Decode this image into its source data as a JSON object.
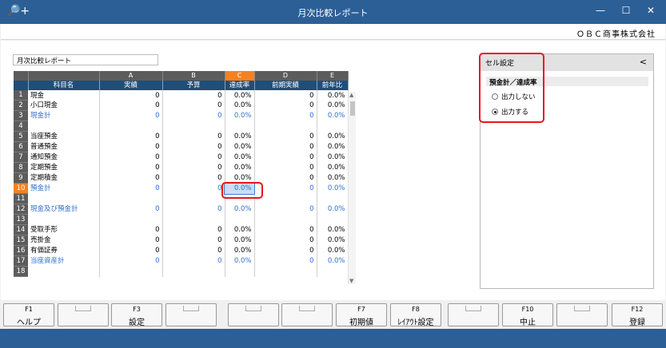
{
  "window": {
    "title": "月次比較レポート",
    "app_icon": "🔎+",
    "min": "—",
    "max": "☐",
    "close": "✕"
  },
  "company": "ＯＢＣ商事株式会社",
  "report_name": "月次比較レポート",
  "grid": {
    "col_letters": [
      "A",
      "B",
      "C",
      "D",
      "E"
    ],
    "headers": [
      "科目名",
      "実績",
      "予算",
      "達成率",
      "前期実績",
      "前年比"
    ],
    "rows": [
      {
        "n": "1",
        "name": "現金",
        "a": "0",
        "b": "0",
        "c": "0.0%",
        "d": "0",
        "e": "0.0%",
        "blue": false
      },
      {
        "n": "2",
        "name": "小口現金",
        "a": "0",
        "b": "0",
        "c": "0.0%",
        "d": "0",
        "e": "0.0%",
        "blue": false
      },
      {
        "n": "3",
        "name": "現金計",
        "a": "0",
        "b": "0",
        "c": "0.0%",
        "d": "0",
        "e": "0.0%",
        "blue": true
      },
      {
        "n": "4",
        "name": "",
        "a": "",
        "b": "",
        "c": "",
        "d": "",
        "e": "",
        "blue": false
      },
      {
        "n": "5",
        "name": "当座預金",
        "a": "0",
        "b": "0",
        "c": "0.0%",
        "d": "0",
        "e": "0.0%",
        "blue": false
      },
      {
        "n": "6",
        "name": "普通預金",
        "a": "0",
        "b": "0",
        "c": "0.0%",
        "d": "0",
        "e": "0.0%",
        "blue": false
      },
      {
        "n": "7",
        "name": "通知預金",
        "a": "0",
        "b": "0",
        "c": "0.0%",
        "d": "0",
        "e": "0.0%",
        "blue": false
      },
      {
        "n": "8",
        "name": "定期預金",
        "a": "0",
        "b": "0",
        "c": "0.0%",
        "d": "0",
        "e": "0.0%",
        "blue": false
      },
      {
        "n": "9",
        "name": "定期積金",
        "a": "0",
        "b": "0",
        "c": "0.0%",
        "d": "0",
        "e": "0.0%",
        "blue": false
      },
      {
        "n": "10",
        "name": "預金計",
        "a": "0",
        "b": "0",
        "c": "0.0%",
        "d": "0",
        "e": "0.0%",
        "blue": true
      },
      {
        "n": "11",
        "name": "",
        "a": "",
        "b": "",
        "c": "",
        "d": "",
        "e": "",
        "blue": false
      },
      {
        "n": "12",
        "name": "現金及び預金計",
        "a": "0",
        "b": "0",
        "c": "0.0%",
        "d": "0",
        "e": "0.0%",
        "blue": true
      },
      {
        "n": "13",
        "name": "",
        "a": "",
        "b": "",
        "c": "",
        "d": "",
        "e": "",
        "blue": false
      },
      {
        "n": "14",
        "name": "受取手形",
        "a": "0",
        "b": "0",
        "c": "0.0%",
        "d": "0",
        "e": "0.0%",
        "blue": false
      },
      {
        "n": "15",
        "name": "売掛金",
        "a": "0",
        "b": "0",
        "c": "0.0%",
        "d": "0",
        "e": "0.0%",
        "blue": false
      },
      {
        "n": "16",
        "name": "有価証券",
        "a": "0",
        "b": "0",
        "c": "0.0%",
        "d": "0",
        "e": "0.0%",
        "blue": false
      },
      {
        "n": "17",
        "name": "当座資産計",
        "a": "0",
        "b": "0",
        "c": "0.0%",
        "d": "0",
        "e": "0.0%",
        "blue": true
      },
      {
        "n": "18",
        "name": "",
        "a": "",
        "b": "",
        "c": "",
        "d": "",
        "e": "",
        "blue": false
      }
    ]
  },
  "panel": {
    "title": "セル設定",
    "collapse": "<",
    "section": "預金計／達成率",
    "options": [
      {
        "label": "出力しない",
        "selected": false
      },
      {
        "label": "出力する",
        "selected": true
      }
    ]
  },
  "fkeys": [
    {
      "key": "F1",
      "label": "ヘルプ"
    },
    {
      "key": "",
      "label": ""
    },
    {
      "key": "F3",
      "label": "設定"
    },
    {
      "key": "",
      "label": ""
    },
    {
      "key": "",
      "label": ""
    },
    {
      "key": "",
      "label": ""
    },
    {
      "key": "F7",
      "label": "初期値"
    },
    {
      "key": "F8",
      "label": "ﾚｲｱｳﾄ設定"
    },
    {
      "key": "",
      "label": ""
    },
    {
      "key": "F10",
      "label": "中止"
    },
    {
      "key": "",
      "label": ""
    },
    {
      "key": "F12",
      "label": "登録"
    }
  ]
}
